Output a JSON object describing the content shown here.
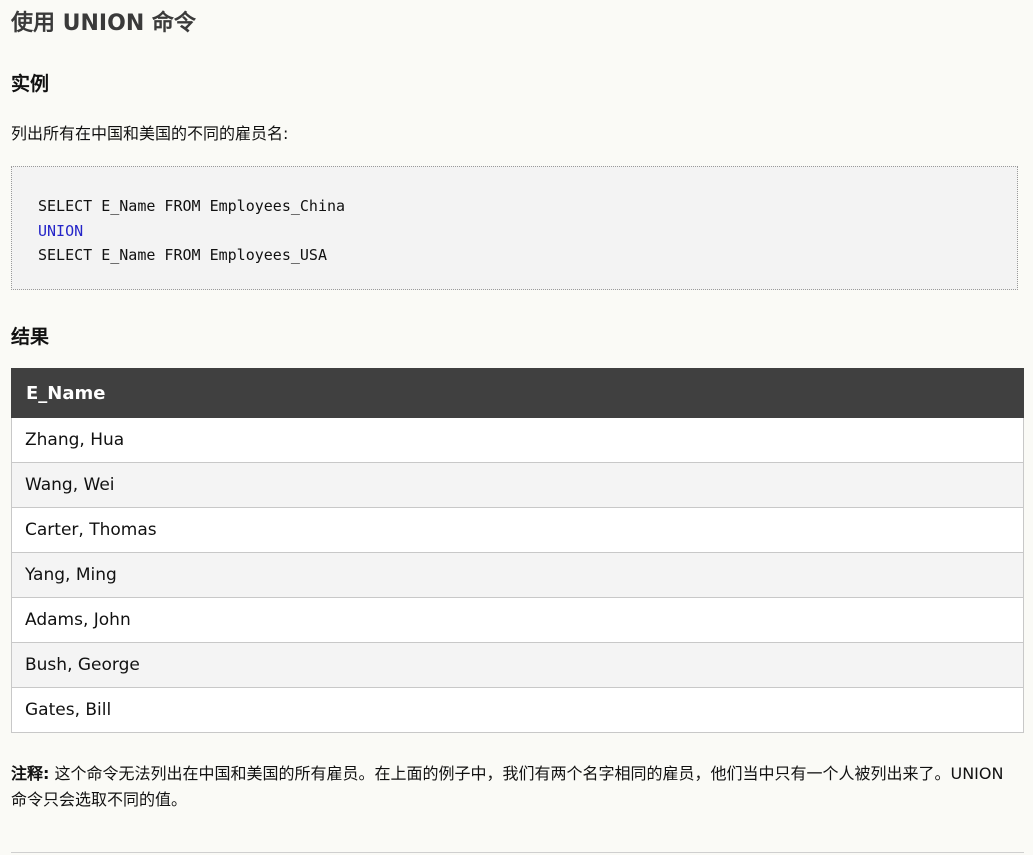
{
  "page": {
    "title": "使用 UNION 命令"
  },
  "example": {
    "heading": "实例",
    "description": "列出所有在中国和美国的不同的雇员名:",
    "code": {
      "line1": "SELECT E_Name FROM Employees_China",
      "line2": "UNION",
      "line3": "SELECT E_Name FROM Employees_USA"
    }
  },
  "result": {
    "heading": "结果",
    "header": "E_Name",
    "rows": [
      "Zhang, Hua",
      "Wang, Wei",
      "Carter, Thomas",
      "Yang, Ming",
      "Adams, John",
      "Bush, George",
      "Gates, Bill"
    ]
  },
  "note": {
    "label": "注释:",
    "text": "这个命令无法列出在中国和美国的所有雇员。在上面的例子中，我们有两个名字相同的雇员，他们当中只有一个人被列出来了。UNION 命令只会选取不同的值。"
  },
  "colors": {
    "background": "#fafaf6",
    "table_header": "#404040",
    "keyword": "#2424c8"
  }
}
